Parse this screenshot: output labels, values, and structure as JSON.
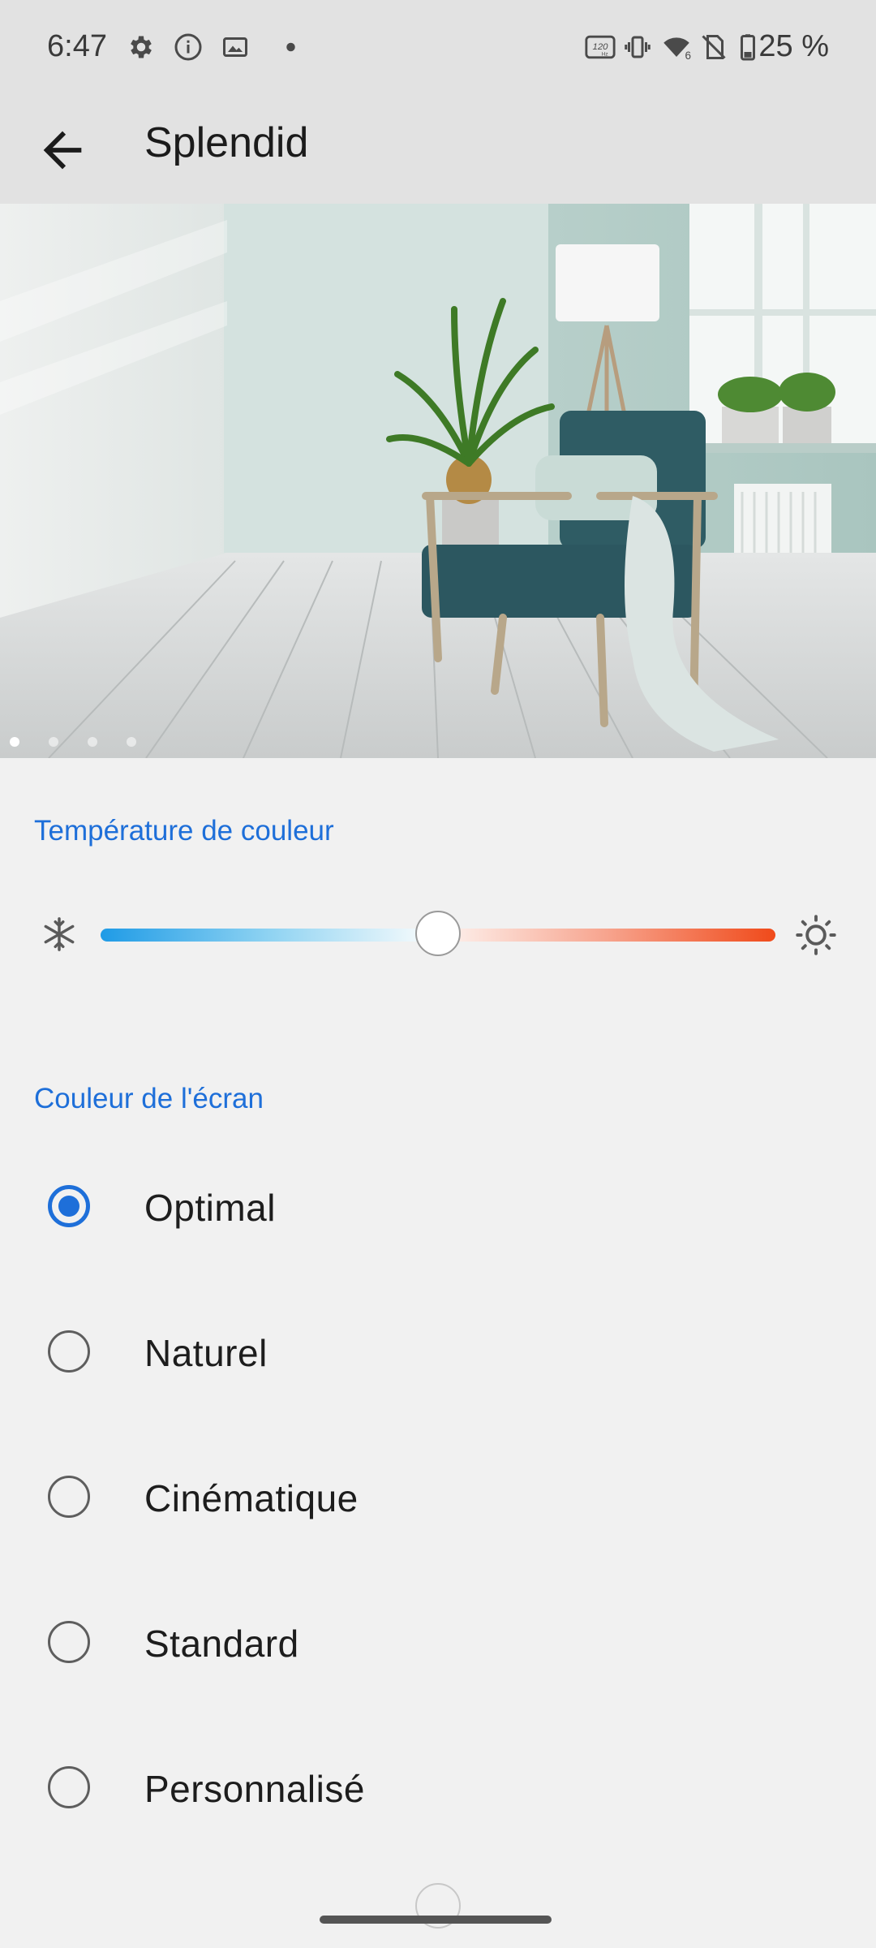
{
  "status_bar": {
    "time": "6:47",
    "battery_percent": "25 %",
    "refresh_rate_badge": "120 Hz",
    "icons": [
      "settings-icon",
      "info-icon",
      "image-icon",
      "dot-icon",
      "refresh-rate-icon",
      "vibrate-icon",
      "wifi-icon",
      "no-sim-icon",
      "battery-icon"
    ]
  },
  "app_bar": {
    "title": "Splendid"
  },
  "preview": {
    "page_count": 4,
    "current_page": 1
  },
  "color_temperature": {
    "header": "Température de couleur",
    "value_fraction": 0.5,
    "left_icon": "snowflake-icon",
    "right_icon": "sun-icon"
  },
  "screen_color": {
    "header": "Couleur de l'écran",
    "options": [
      {
        "label": "Optimal",
        "selected": true
      },
      {
        "label": "Naturel",
        "selected": false
      },
      {
        "label": "Cinématique",
        "selected": false
      },
      {
        "label": "Standard",
        "selected": false
      },
      {
        "label": "Personnalisé",
        "selected": false
      }
    ]
  },
  "colors": {
    "accent": "#1e6fd9",
    "background": "#f1f1f1",
    "bar": "#e2e2e2"
  }
}
